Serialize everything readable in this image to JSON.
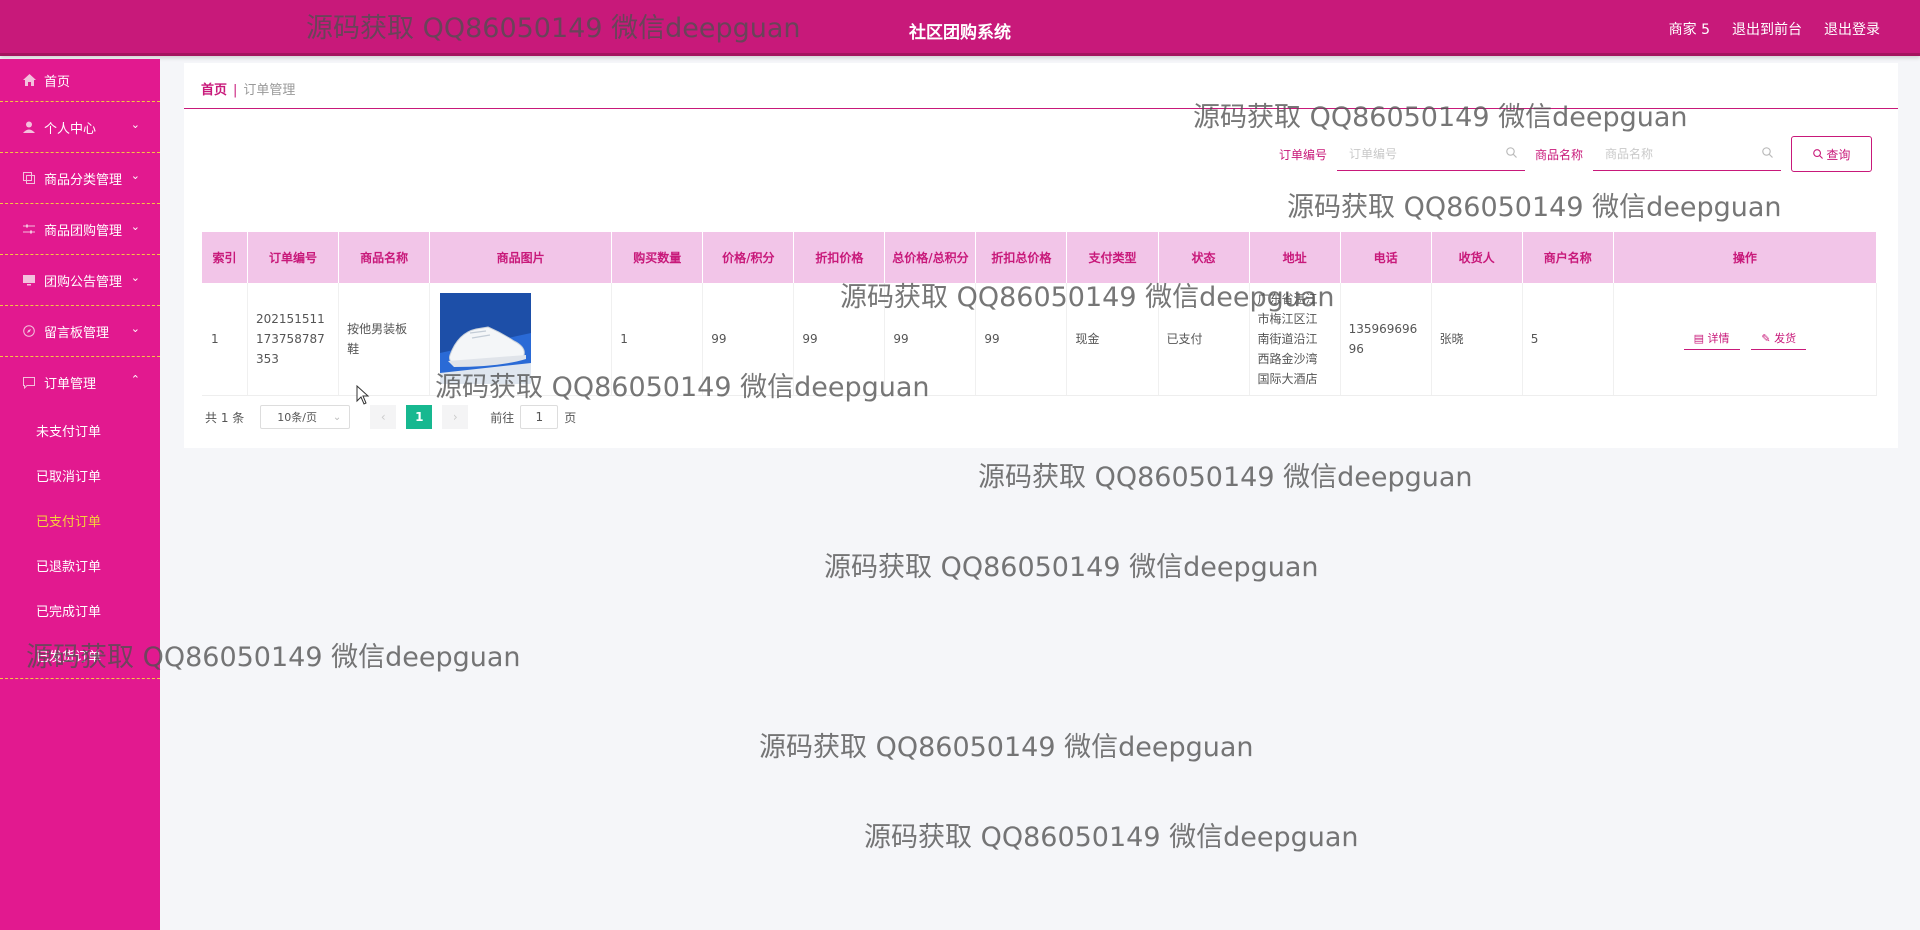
{
  "header": {
    "title": "社区团购系统",
    "links": [
      "商家 5",
      "退出到前台",
      "退出登录"
    ]
  },
  "sidebar": {
    "items": [
      {
        "label": "首页",
        "icon": "home-icon"
      },
      {
        "label": "个人中心",
        "icon": "user-icon"
      },
      {
        "label": "商品分类管理",
        "icon": "copy-icon"
      },
      {
        "label": "商品团购管理",
        "icon": "sliders-icon"
      },
      {
        "label": "团购公告管理",
        "icon": "monitor-icon"
      },
      {
        "label": "留言板管理",
        "icon": "compass-icon"
      },
      {
        "label": "订单管理",
        "icon": "message-icon"
      }
    ],
    "order_sub": [
      "未支付订单",
      "已取消订单",
      "已支付订单",
      "已退款订单",
      "已完成订单",
      "已发货订单"
    ],
    "active_sub": "已支付订单"
  },
  "breadcrumb": {
    "home": "首页",
    "sep": "|",
    "current": "订单管理"
  },
  "search": {
    "order_label": "订单编号",
    "order_placeholder": "订单编号",
    "product_label": "商品名称",
    "product_placeholder": "商品名称",
    "query_button": "查询"
  },
  "table": {
    "headers": [
      "索引",
      "订单编号",
      "商品名称",
      "商品图片",
      "购买数量",
      "价格/积分",
      "折扣价格",
      "总价格/总积分",
      "折扣总价格",
      "支付类型",
      "状态",
      "地址",
      "电话",
      "收货人",
      "商户名称",
      "操作"
    ],
    "rows": [
      {
        "index": "1",
        "order_no_1": "202151511",
        "order_no_2": "173758787",
        "order_no_3": "353",
        "product_1": "按他男装板",
        "product_2": "鞋",
        "qty": "1",
        "price": "99",
        "discount_price": "99",
        "total": "99",
        "discount_total": "99",
        "pay_type": "现金",
        "status": "已支付",
        "addr_1": "广东省湛江",
        "addr_2": "市梅江区江",
        "addr_3": "南街道沿江",
        "addr_4": "西路金沙湾",
        "addr_5": "国际大酒店",
        "phone_1": "135969696",
        "phone_2": "96",
        "receiver": "张晓",
        "merchant": "5",
        "detail_btn": "详情",
        "ship_btn": "发货"
      }
    ]
  },
  "pagination": {
    "total": "共 1 条",
    "page_size": "10条/页",
    "current_page": "1",
    "goto_label": "前往",
    "goto_value": "1",
    "page_unit": "页"
  },
  "watermark": "源码获取 QQ86050149 微信deepguan",
  "colors": {
    "brand": "#c8197a",
    "sidebar": "#e2198f",
    "active_page": "#17b890"
  }
}
